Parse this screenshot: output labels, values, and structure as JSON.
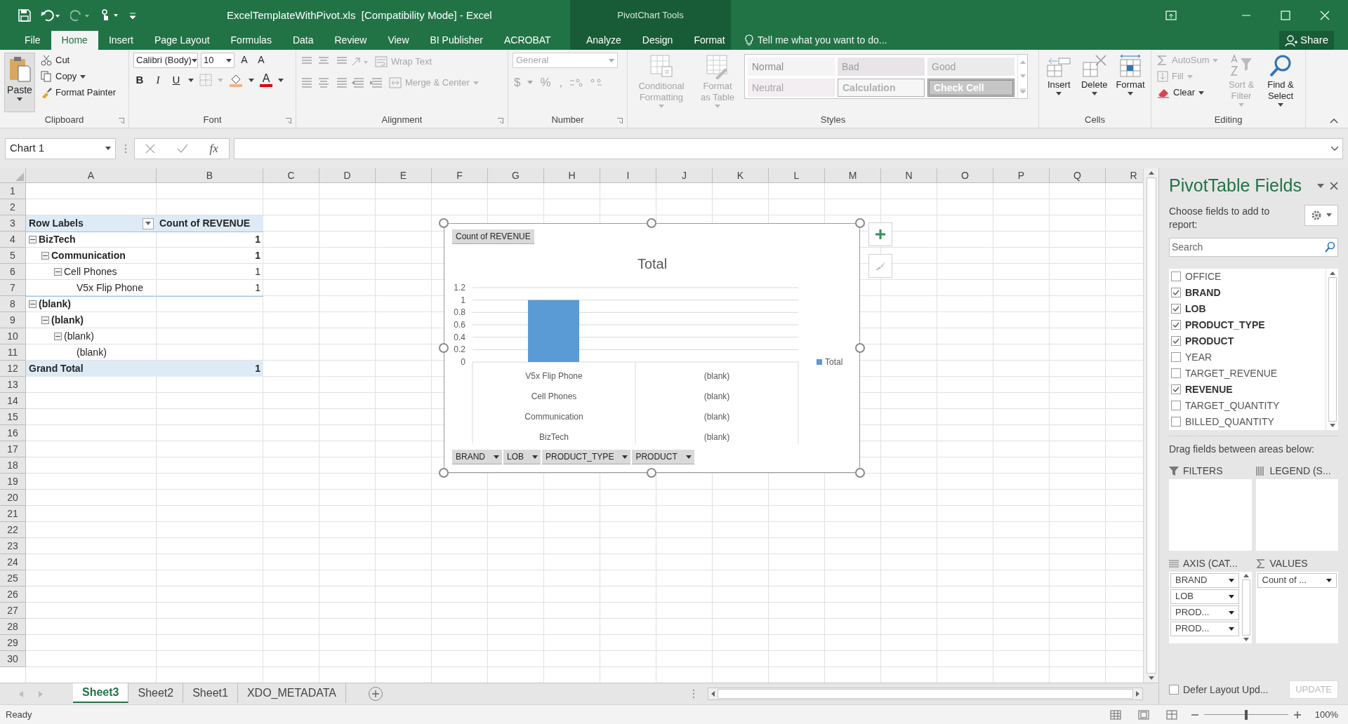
{
  "title_bar": {
    "title": "ExcelTemplateWithPivot.xls  [Compatibility Mode] - Excel",
    "context_label": "PivotChart Tools"
  },
  "ribbon_tabs": [
    {
      "label": "File",
      "selected": false,
      "contextual": false
    },
    {
      "label": "Home",
      "selected": true,
      "contextual": false
    },
    {
      "label": "Insert",
      "selected": false,
      "contextual": false
    },
    {
      "label": "Page Layout",
      "selected": false,
      "contextual": false
    },
    {
      "label": "Formulas",
      "selected": false,
      "contextual": false
    },
    {
      "label": "Data",
      "selected": false,
      "contextual": false
    },
    {
      "label": "Review",
      "selected": false,
      "contextual": false
    },
    {
      "label": "View",
      "selected": false,
      "contextual": false
    },
    {
      "label": "BI Publisher",
      "selected": false,
      "contextual": false
    },
    {
      "label": "ACROBAT",
      "selected": false,
      "contextual": false
    },
    {
      "label": "Analyze",
      "selected": false,
      "contextual": true
    },
    {
      "label": "Design",
      "selected": false,
      "contextual": true
    },
    {
      "label": "Format",
      "selected": false,
      "contextual": true
    }
  ],
  "tell_me": {
    "placeholder": "Tell me what you want to do..."
  },
  "share_button": "Share",
  "ribbon_groups": [
    {
      "label": "Clipboard",
      "kind": "clipboard",
      "items": [
        {
          "label": "Paste",
          "disabled": false
        },
        {
          "label": "Cut",
          "disabled": false
        },
        {
          "label": "Copy",
          "disabled": false
        },
        {
          "label": "Format Painter",
          "disabled": false
        }
      ]
    },
    {
      "label": "Font",
      "kind": "font",
      "font_name": "Calibri (Body)",
      "font_size": "10",
      "size_buttons": [
        "A",
        "A"
      ],
      "style_buttons": [
        "B",
        "I",
        "U"
      ],
      "color_button": "A"
    },
    {
      "label": "Alignment",
      "kind": "alignment",
      "items": [
        {
          "label": "Wrap Text",
          "disabled": true
        },
        {
          "label": "Merge & Center",
          "disabled": true
        }
      ]
    },
    {
      "label": "Number",
      "kind": "number",
      "disabled": true,
      "format": "General",
      "symbols": [
        "$",
        "%",
        ","
      ]
    },
    {
      "label": "Styles",
      "kind": "styles",
      "items": [
        {
          "label": "Conditional Formatting",
          "disabled": true
        },
        {
          "label": "Format as Table",
          "disabled": true
        }
      ],
      "cell_styles": [
        {
          "label": "Normal",
          "kind": "normal"
        },
        {
          "label": "Bad",
          "kind": "bad"
        },
        {
          "label": "Good",
          "kind": "good"
        },
        {
          "label": "Neutral",
          "kind": "neutral"
        },
        {
          "label": "Calculation",
          "kind": "calculation"
        },
        {
          "label": "Check Cell",
          "kind": "check"
        }
      ]
    },
    {
      "label": "Cells",
      "kind": "cells",
      "items": [
        {
          "label": "Insert",
          "disabled": false
        },
        {
          "label": "Delete",
          "disabled": false
        },
        {
          "label": "Format",
          "disabled": false
        }
      ]
    },
    {
      "label": "Editing",
      "kind": "editing",
      "items": [
        {
          "label": "AutoSum",
          "disabled": true
        },
        {
          "label": "Fill",
          "disabled": true
        },
        {
          "label": "Clear",
          "disabled": false
        },
        {
          "label": "Sort & Filter",
          "disabled": true
        },
        {
          "label": "Find & Select",
          "disabled": false
        }
      ]
    }
  ],
  "formula_bar": {
    "name_box": "Chart 1",
    "function_label": "fx"
  },
  "sheet": {
    "columns": [
      "A",
      "B",
      "C",
      "D",
      "E",
      "F",
      "G",
      "H",
      "I",
      "J",
      "K",
      "L",
      "M",
      "N",
      "O",
      "P",
      "Q",
      "R"
    ],
    "rows": [
      "1",
      "2",
      "3",
      "4",
      "5",
      "6",
      "7",
      "8",
      "9",
      "10",
      "11",
      "12",
      "13",
      "14",
      "15",
      "16",
      "17",
      "18",
      "19",
      "20",
      "21",
      "22",
      "23",
      "24",
      "25",
      "26",
      "27",
      "28",
      "29",
      "30"
    ],
    "pivot": {
      "columns": [
        "Row Labels",
        "Count of REVENUE"
      ],
      "rows": [
        {
          "label": "BizTech",
          "value": "1",
          "expanded": true,
          "children": [
            {
              "label": "Communication",
              "value": "1",
              "expanded": true,
              "children": [
                {
                  "label": "Cell Phones",
                  "value": "1",
                  "expanded": true,
                  "children": [
                    {
                      "label": "V5x Flip Phone",
                      "value": "1"
                    }
                  ]
                }
              ]
            }
          ]
        },
        {
          "label": "(blank)",
          "expanded": true,
          "children": [
            {
              "label": "(blank)",
              "expanded": true,
              "children": [
                {
                  "label": "(blank)",
                  "expanded": true,
                  "children": [
                    {
                      "label": "(blank)"
                    }
                  ]
                }
              ]
            }
          ]
        }
      ],
      "grand_total": {
        "label": "Grand Total",
        "value": "1"
      }
    }
  },
  "chart": {
    "value_button": "Count of REVENUE",
    "chart_data": {
      "type": "bar",
      "title": "Total",
      "categories": [
        "V5x Flip Phone",
        "(blank)"
      ],
      "series": [
        {
          "name": "Total",
          "color": "#5b9bd5",
          "values": [
            1,
            null
          ]
        }
      ],
      "grid": true,
      "ylim": [
        0,
        1.2
      ],
      "yticks": [
        0,
        0.2,
        0.4,
        0.6,
        0.8,
        1,
        1.2
      ]
    },
    "outer_category_levels": [
      [
        "Cell Phones",
        "(blank)"
      ],
      [
        "Communication",
        "(blank)"
      ],
      [
        "BizTech",
        "(blank)"
      ]
    ],
    "field_buttons": [
      "BRAND",
      "LOB",
      "PRODUCT_TYPE",
      "PRODUCT"
    ]
  },
  "sheet_tabs": [
    {
      "label": "Sheet3",
      "selected": true
    },
    {
      "label": "Sheet2",
      "selected": false
    },
    {
      "label": "Sheet1",
      "selected": false
    },
    {
      "label": "XDO_METADATA",
      "selected": false
    }
  ],
  "pivot_panel": {
    "title": "PivotTable Fields",
    "subtitle": "Choose fields to add to report:",
    "search": {
      "placeholder": "Search"
    },
    "fields": [
      {
        "label": "OFFICE",
        "checked": false
      },
      {
        "label": "BRAND",
        "checked": true
      },
      {
        "label": "LOB",
        "checked": true
      },
      {
        "label": "PRODUCT_TYPE",
        "checked": true
      },
      {
        "label": "PRODUCT",
        "checked": true
      },
      {
        "label": "YEAR",
        "checked": false
      },
      {
        "label": "TARGET_REVENUE",
        "checked": false
      },
      {
        "label": "REVENUE",
        "checked": true
      },
      {
        "label": "TARGET_QUANTITY",
        "checked": false
      },
      {
        "label": "BILLED_QUANTITY",
        "checked": false
      }
    ],
    "drag_hint": "Drag fields between areas below:",
    "areas": [
      {
        "label": "FILTERS",
        "kind": "filters"
      },
      {
        "label": "LEGEND (S...",
        "kind": "legend"
      },
      {
        "label": "AXIS (CAT...",
        "kind": "axis",
        "items": [
          "BRAND",
          "LOB",
          "PROD...",
          "PROD..."
        ]
      },
      {
        "label": "VALUES",
        "kind": "values",
        "items": [
          "Count of ..."
        ]
      }
    ],
    "defer": {
      "label": "Defer Layout Upd...",
      "checked": false
    },
    "update_button": {
      "label": "UPDATE",
      "disabled": true
    }
  },
  "status_bar": {
    "status": "Ready",
    "zoom": "100%",
    "zoom_slider": {
      "level": 0.5
    }
  }
}
